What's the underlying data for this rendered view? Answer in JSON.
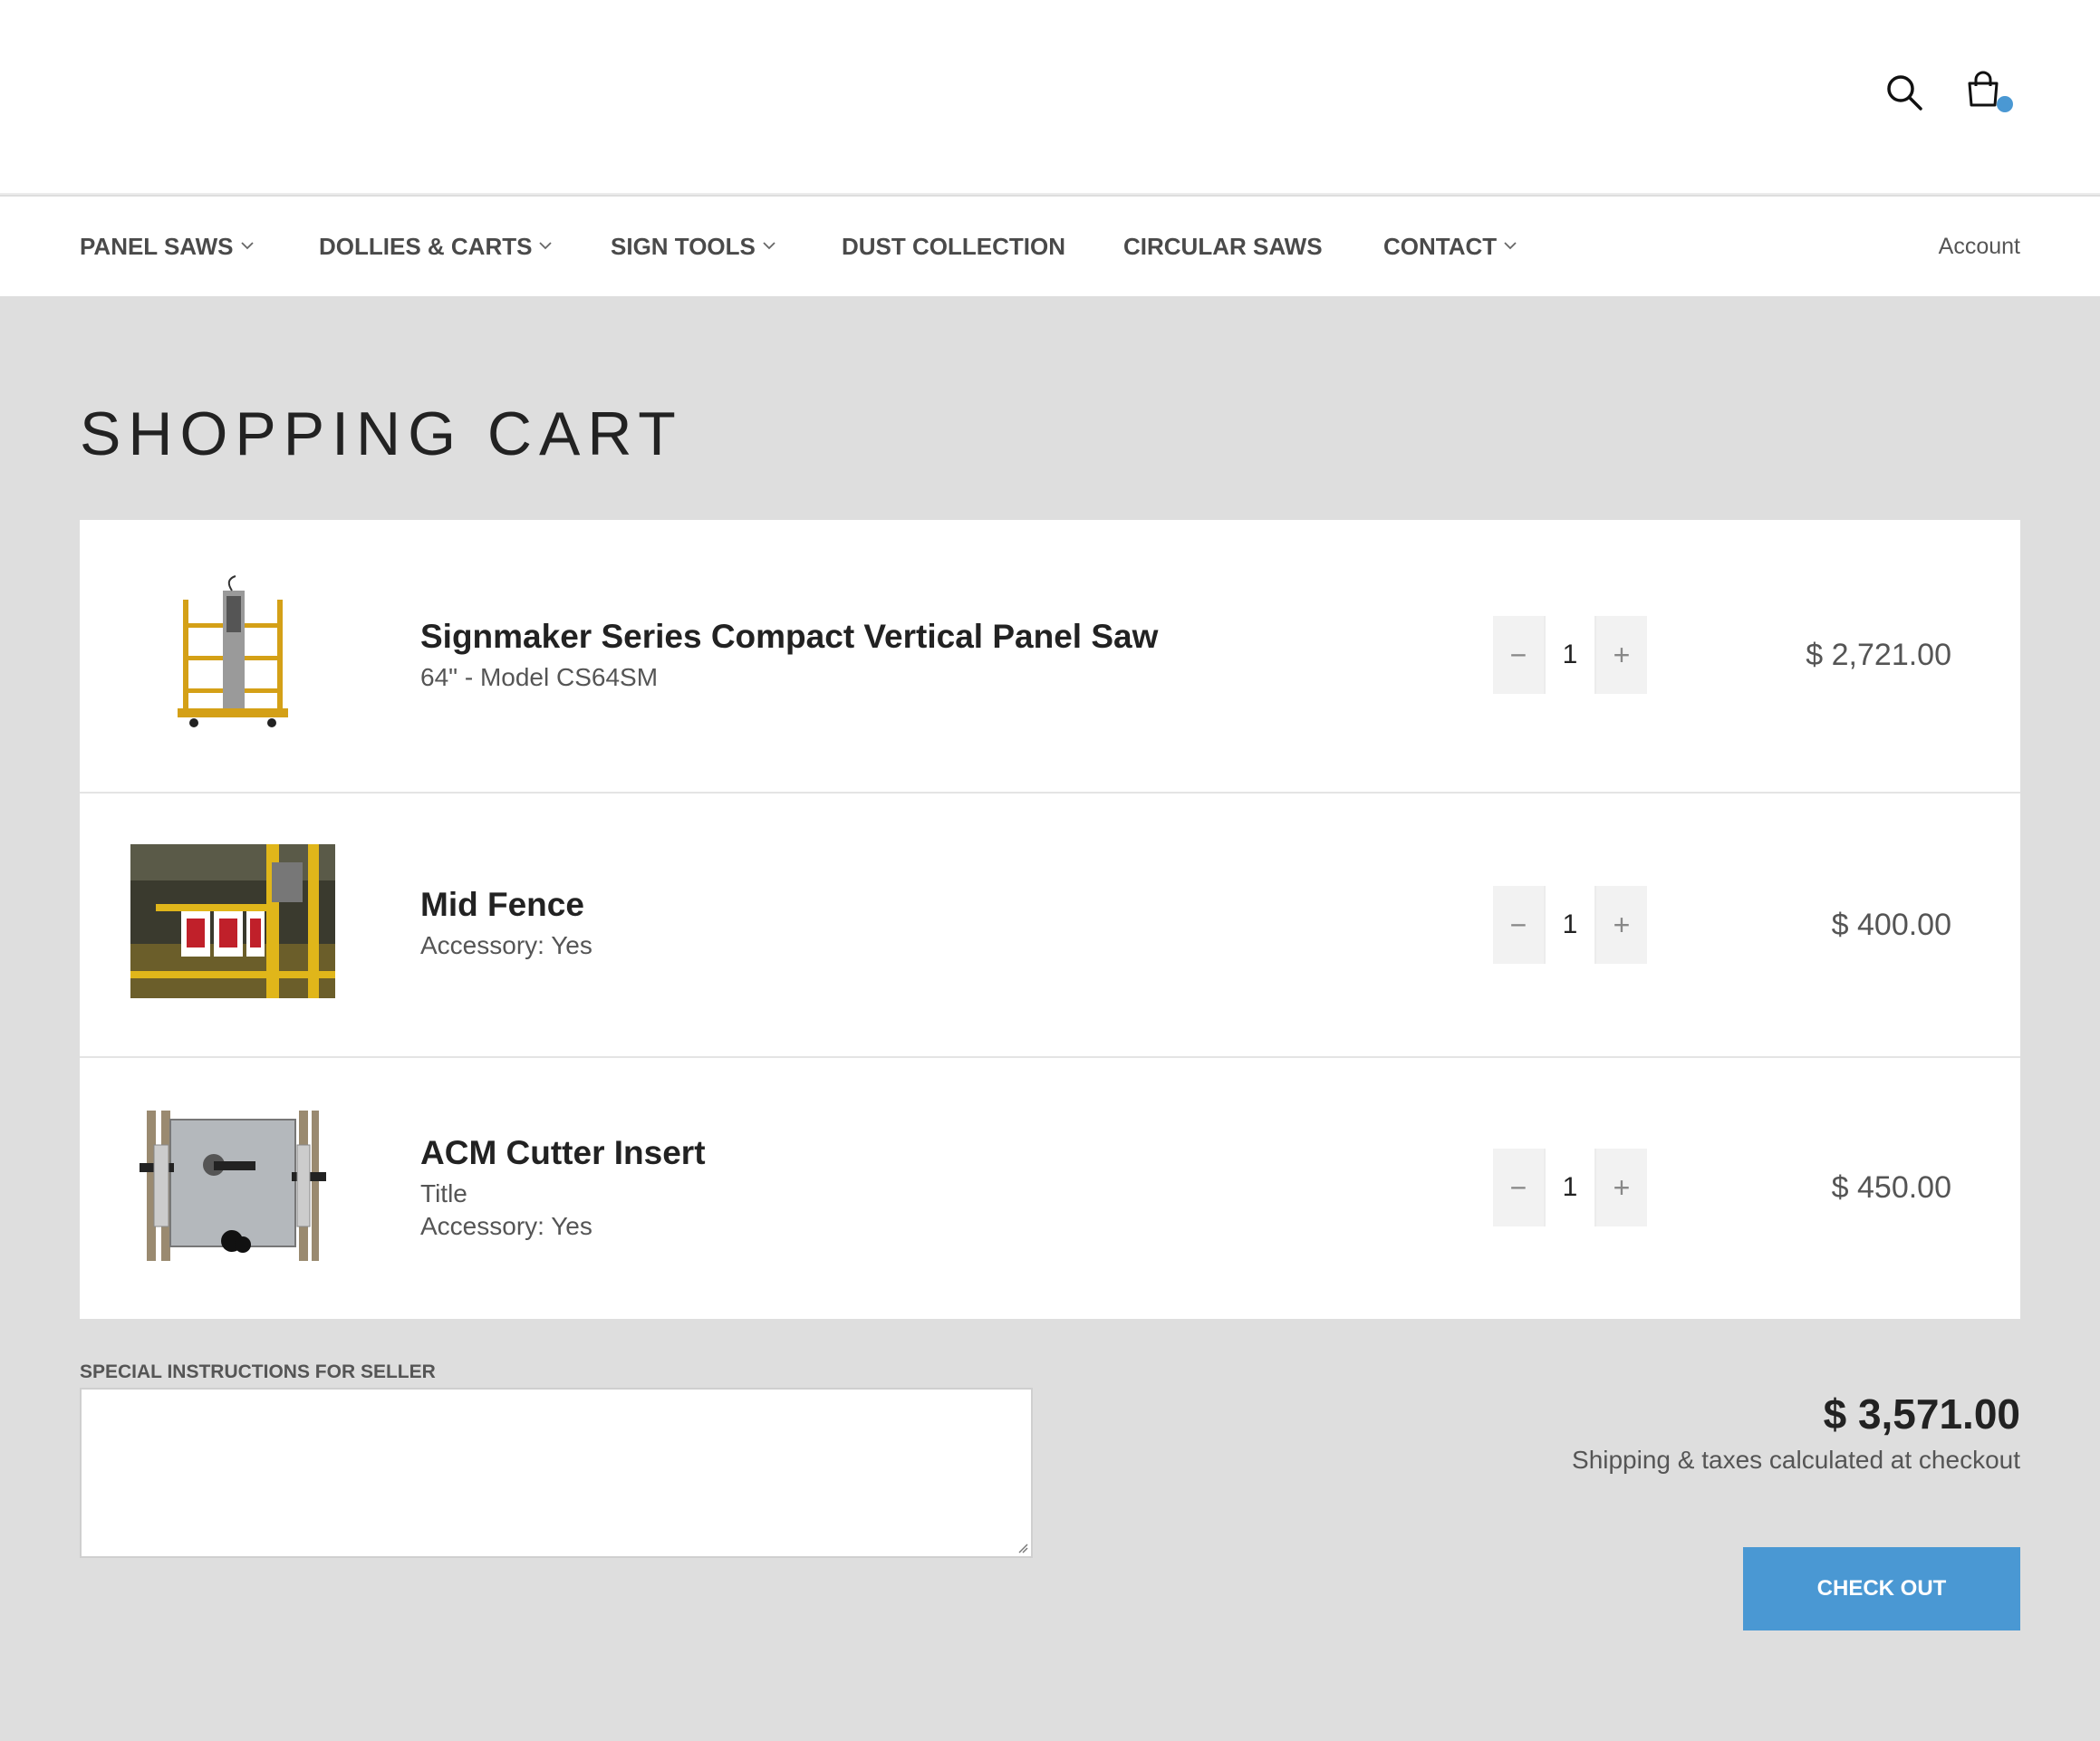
{
  "header": {
    "search_icon": "search-icon",
    "cart_icon": "shopping-bag-icon",
    "cart_badge_color": "#4a98d3"
  },
  "nav": {
    "items": [
      {
        "label": "PANEL SAWS",
        "dropdown": true
      },
      {
        "label": "DOLLIES & CARTS",
        "dropdown": true
      },
      {
        "label": "SIGN TOOLS",
        "dropdown": true
      },
      {
        "label": "DUST COLLECTION",
        "dropdown": false
      },
      {
        "label": "CIRCULAR SAWS",
        "dropdown": false
      },
      {
        "label": "CONTACT",
        "dropdown": true
      }
    ],
    "account": "Account"
  },
  "page": {
    "title": "SHOPPING CART"
  },
  "cart": {
    "items": [
      {
        "title": "Signmaker Series Compact Vertical Panel Saw",
        "meta": [
          "64\" - Model CS64SM"
        ],
        "quantity": "1",
        "price": "$ 2,721.00"
      },
      {
        "title": "Mid Fence",
        "meta": [
          "Accessory: Yes"
        ],
        "quantity": "1",
        "price": "$ 400.00"
      },
      {
        "title": "ACM Cutter Insert",
        "meta": [
          "Title",
          "Accessory: Yes"
        ],
        "quantity": "1",
        "price": "$ 450.00"
      }
    ],
    "qty_minus": "−",
    "qty_plus": "+"
  },
  "footer": {
    "instructions_label": "SPECIAL INSTRUCTIONS FOR SELLER",
    "instructions_value": "",
    "subtotal": "$ 3,571.00",
    "shipping_note": "Shipping & taxes calculated at checkout",
    "checkout_label": "CHECK OUT",
    "accent_color": "#4a98d3"
  }
}
